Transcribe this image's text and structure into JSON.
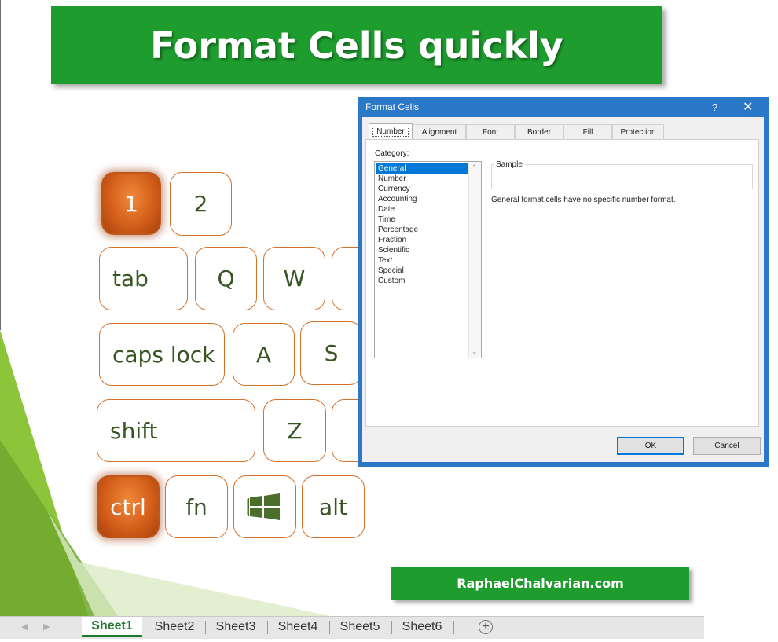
{
  "title": "Format Cells quickly",
  "keys": {
    "k1": "1",
    "k2": "2",
    "tab": "tab",
    "q": "Q",
    "w": "W",
    "caps": "caps lock",
    "a": "A",
    "s": "S",
    "shift": "shift",
    "z": "Z",
    "ctrl": "ctrl",
    "fn": "fn",
    "win_icon": "windows-icon",
    "alt": "alt"
  },
  "dialog": {
    "title": "Format Cells",
    "help": "?",
    "close": "✕",
    "tabs": [
      "Number",
      "Alignment",
      "Font",
      "Border",
      "Fill",
      "Protection"
    ],
    "category_label": "Category:",
    "categories": [
      "General",
      "Number",
      "Currency",
      "Accounting",
      "Date",
      "Time",
      "Percentage",
      "Fraction",
      "Scientific",
      "Text",
      "Special",
      "Custom"
    ],
    "selected_category": "General",
    "sample_label": "Sample",
    "description": "General format cells have no specific number format.",
    "ok": "OK",
    "cancel": "Cancel"
  },
  "footer": {
    "site": "RaphaelChalvarian.com"
  },
  "sheets": {
    "tabs": [
      "Sheet1",
      "Sheet2",
      "Sheet3",
      "Sheet4",
      "Sheet5",
      "Sheet6"
    ],
    "active": "Sheet1",
    "add": "+"
  },
  "colors": {
    "banner_green": "#1e9c2e",
    "key_orange": "#d45f1a",
    "key_text": "#375623",
    "dialog_blue": "#2b78c9",
    "selection_blue": "#0078d7"
  }
}
